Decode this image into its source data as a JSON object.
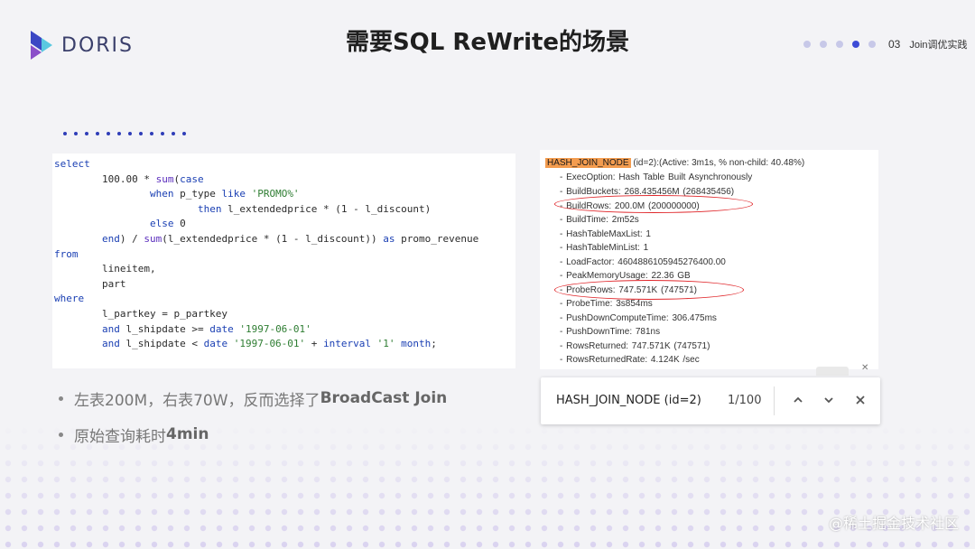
{
  "header": {
    "logo_text": "DORIS",
    "title": "需要SQL ReWrite的场景",
    "page_number": "03",
    "section_title": "Join调优实践"
  },
  "code_lines": [
    "select",
    "        100.00 * sum(case",
    "                when p_type like 'PROMO%'",
    "                        then l_extendedprice * (1 - l_discount)",
    "                else 0",
    "        end) / sum(l_extendedprice * (1 - l_discount)) as promo_revenue",
    "from",
    "        lineitem,",
    "        part",
    "where",
    "        l_partkey = p_partkey",
    "        and l_shipdate >= date '1997-06-01'",
    "        and l_shipdate < date '1997-06-01' + interval '1' month;"
  ],
  "bullets": [
    {
      "text": "左表200M，右表70W，反而选择了",
      "bold": "BroadCast Join"
    },
    {
      "text": "原始查询耗时",
      "bold": "4min"
    }
  ],
  "profile": {
    "node_name": "HASH_JOIN_NODE",
    "node_suffix": "(id=2):(Active: 3m1s, % non-child: 40.48%)",
    "lines": [
      "- ExecOption: Hash Table Built Asynchronously",
      "- BuildBuckets: 268.435456M (268435456)",
      "- BuildRows: 200.0M (200000000)",
      "- BuildTime: 2m52s",
      "- HashTableMaxList: 1",
      "- HashTableMinList: 1",
      "- LoadFactor: 4604886105945276400.00",
      "- PeakMemoryUsage: 22.36 GB",
      "- ProbeRows: 747.571K (747571)",
      "- ProbeTime: 3s854ms",
      "- PushDownComputeTime: 306.475ms",
      "- PushDownTime: 781ns",
      "- RowsReturned: 747.571K (747571)",
      "- RowsReturnedRate: 4.124K /sec"
    ]
  },
  "find_bar": {
    "query": "HASH_JOIN_NODE (id=2)",
    "count": "1/100",
    "icons": [
      "chevron-up-icon",
      "chevron-down-icon",
      "close-icon"
    ]
  },
  "tab_close": "✕",
  "watermark": "@稀土掘金技术社区",
  "colors": {
    "accent": "#3d4bd6",
    "highlight": "#f39c4f",
    "circle": "#e0262a",
    "background": "#f3f3f6"
  }
}
